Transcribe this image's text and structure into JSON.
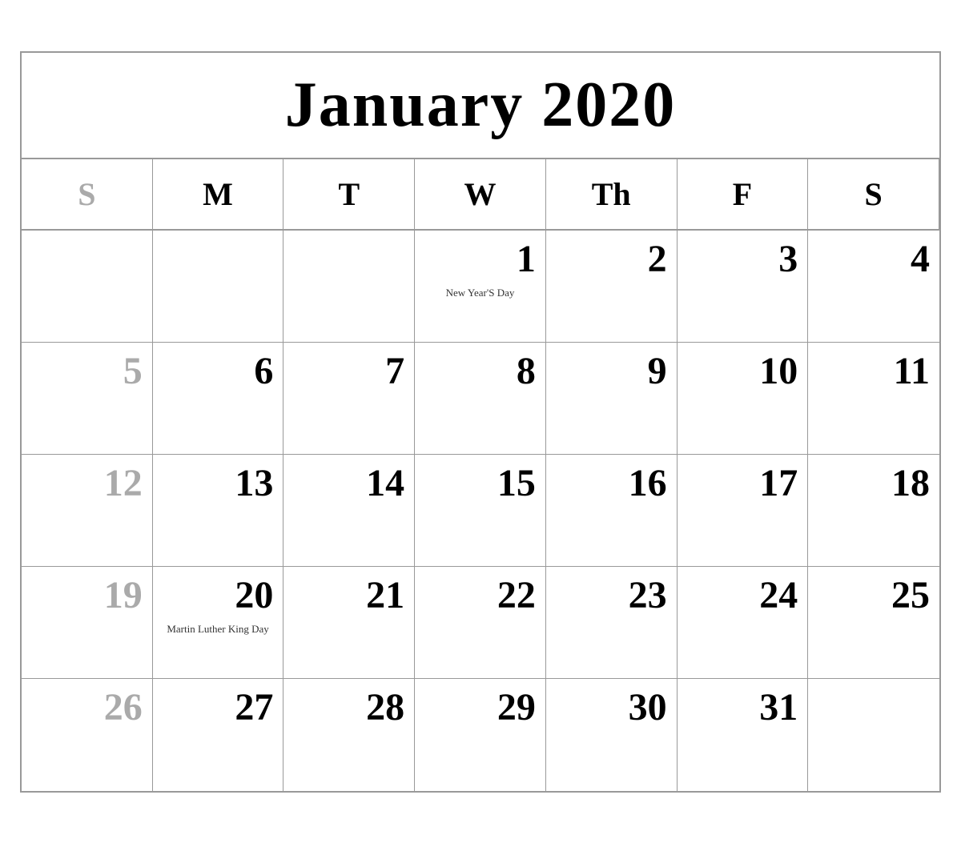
{
  "header": {
    "title": "January 2020"
  },
  "days_of_week": [
    {
      "label": "S",
      "type": "sunday"
    },
    {
      "label": "M",
      "type": "weekday"
    },
    {
      "label": "T",
      "type": "weekday"
    },
    {
      "label": "W",
      "type": "weekday"
    },
    {
      "label": "Th",
      "type": "weekday"
    },
    {
      "label": "F",
      "type": "weekday"
    },
    {
      "label": "S",
      "type": "weekday"
    }
  ],
  "weeks": [
    {
      "days": [
        {
          "number": "",
          "type": "empty"
        },
        {
          "number": "",
          "type": "empty"
        },
        {
          "number": "",
          "type": "empty"
        },
        {
          "number": "1",
          "type": "weekday",
          "event": "New Year'S Day"
        },
        {
          "number": "2",
          "type": "weekday"
        },
        {
          "number": "3",
          "type": "weekday"
        },
        {
          "number": "4",
          "type": "weekday"
        }
      ]
    },
    {
      "days": [
        {
          "number": "5",
          "type": "sunday"
        },
        {
          "number": "6",
          "type": "weekday"
        },
        {
          "number": "7",
          "type": "weekday"
        },
        {
          "number": "8",
          "type": "weekday"
        },
        {
          "number": "9",
          "type": "weekday"
        },
        {
          "number": "10",
          "type": "weekday"
        },
        {
          "number": "11",
          "type": "weekday"
        }
      ]
    },
    {
      "days": [
        {
          "number": "12",
          "type": "sunday"
        },
        {
          "number": "13",
          "type": "weekday"
        },
        {
          "number": "14",
          "type": "weekday"
        },
        {
          "number": "15",
          "type": "weekday"
        },
        {
          "number": "16",
          "type": "weekday"
        },
        {
          "number": "17",
          "type": "weekday"
        },
        {
          "number": "18",
          "type": "weekday"
        }
      ]
    },
    {
      "days": [
        {
          "number": "19",
          "type": "sunday"
        },
        {
          "number": "20",
          "type": "weekday",
          "event": "Martin Luther King Day"
        },
        {
          "number": "21",
          "type": "weekday"
        },
        {
          "number": "22",
          "type": "weekday"
        },
        {
          "number": "23",
          "type": "weekday"
        },
        {
          "number": "24",
          "type": "weekday"
        },
        {
          "number": "25",
          "type": "weekday"
        }
      ]
    },
    {
      "days": [
        {
          "number": "26",
          "type": "sunday"
        },
        {
          "number": "27",
          "type": "weekday"
        },
        {
          "number": "28",
          "type": "weekday"
        },
        {
          "number": "29",
          "type": "weekday"
        },
        {
          "number": "30",
          "type": "weekday"
        },
        {
          "number": "31",
          "type": "weekday"
        },
        {
          "number": "",
          "type": "empty"
        }
      ]
    }
  ]
}
